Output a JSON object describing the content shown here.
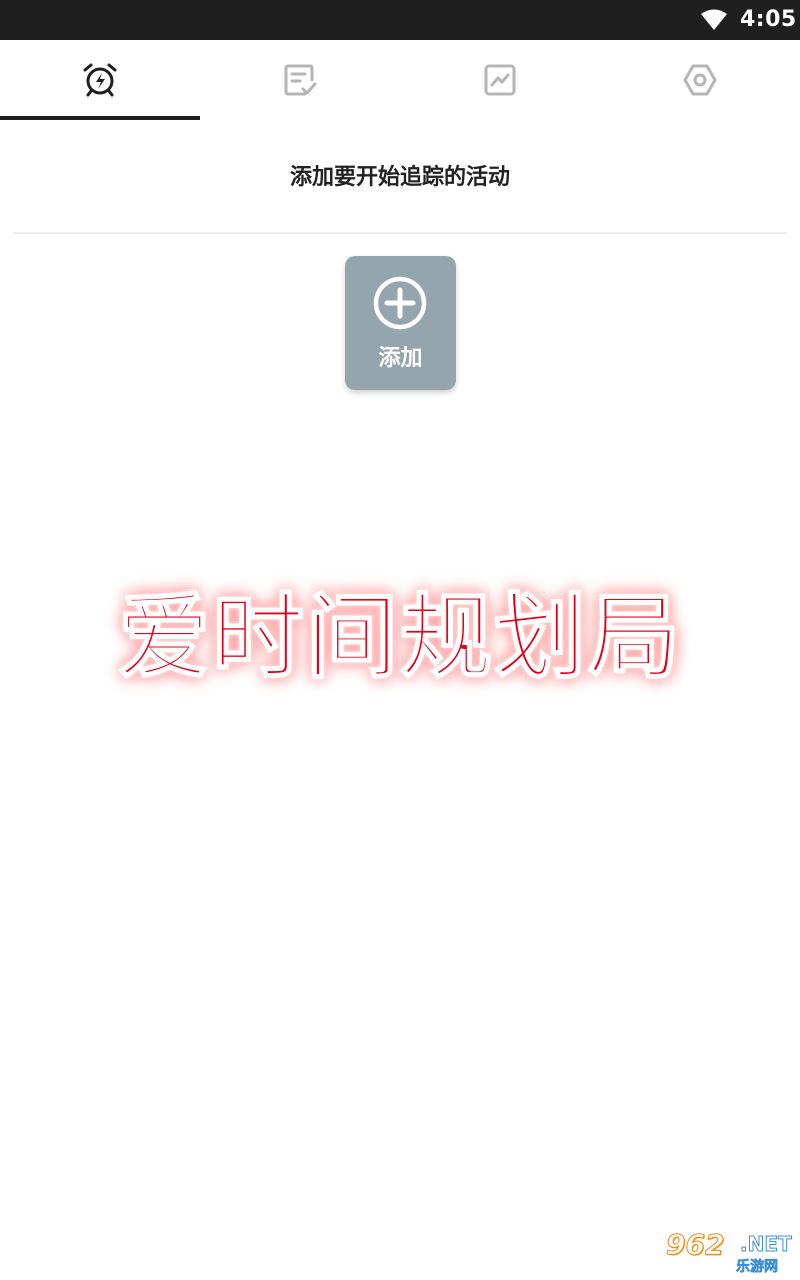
{
  "status_bar": {
    "time": "4:05",
    "icons": [
      "wifi-icon"
    ]
  },
  "tabs": [
    {
      "icon": "alarm-clock-icon",
      "active": true
    },
    {
      "icon": "checklist-note-icon",
      "active": false
    },
    {
      "icon": "line-chart-icon",
      "active": false
    },
    {
      "icon": "settings-hexagon-icon",
      "active": false
    }
  ],
  "colors": {
    "status_bar_bg": "#1f1f1f",
    "active_icon": "#1f1f1f",
    "inactive_icon": "#b5b5b5",
    "add_button_bg": "#95a5ae",
    "overlay_text": "#e2001a"
  },
  "main": {
    "heading": "添加要开始追踪的活动",
    "add_button": {
      "label": "添加",
      "icon": "plus-circle-icon"
    }
  },
  "overlay": {
    "title": "爱时间规划局"
  },
  "watermark": {
    "main": "962",
    "suffix": ".NET",
    "sub": "乐游网"
  }
}
